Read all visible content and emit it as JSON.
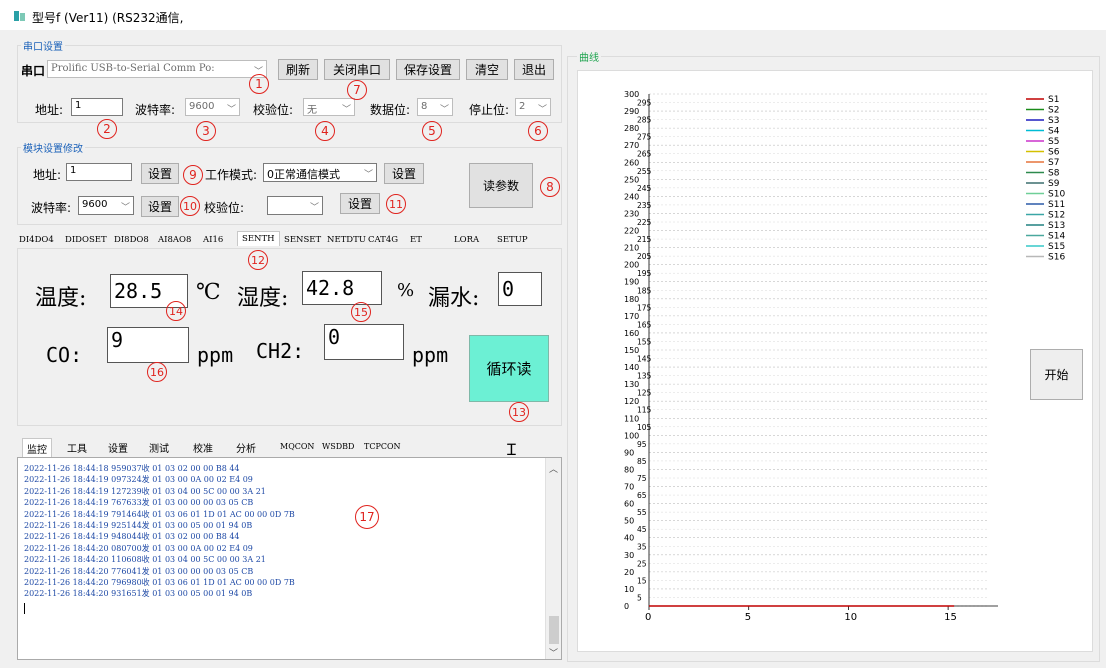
{
  "window": {
    "title": "型号f (Ver11)  (RS232通信,"
  },
  "serial_group": {
    "title": "串口设置",
    "port_label": "串口",
    "port_value": "Prolific USB-to-Serial Comm Po:",
    "refresh": "刷新",
    "close_port": "关闭串口",
    "save": "保存设置",
    "clear": "清空",
    "exit": "退出",
    "address_label": "地址:",
    "address_value": "1",
    "baud_label": "波特率:",
    "baud_value": "9600",
    "parity_label": "校验位:",
    "parity_value": "无",
    "databits_label": "数据位:",
    "databits_value": "8",
    "stopbits_label": "停止位:",
    "stopbits_value": "2"
  },
  "module_group": {
    "title": "模块设置修改",
    "address_label": "地址:",
    "address_value": "1",
    "set1": "设置",
    "workmode_label": "工作模式:",
    "workmode_value": "0正常通信模式",
    "set2": "设置",
    "read_params": "读参数",
    "baud_label": "波特率:",
    "baud_value": "9600",
    "set3": "设置",
    "parity_label": "校验位:",
    "parity_value": "",
    "set4": "设置"
  },
  "device_tabs": [
    "DI4DO4",
    "DIDOSET",
    "DI8DO8",
    "AI8AO8",
    "AI16",
    "SENTH",
    "SENSET",
    "NETDTU",
    "CAT4G",
    "ET",
    "LORA",
    "SETUP"
  ],
  "senth": {
    "temp_label": "温度:",
    "temp_value": "28.5",
    "temp_unit": "℃",
    "hum_label": "湿度:",
    "hum_value": "42.8",
    "hum_unit": "%",
    "leak_label": "漏水:",
    "leak_value": "0",
    "co_label": "CO:",
    "co_value": "9",
    "co_unit": "ppm",
    "ch2_label": "CH2:",
    "ch2_value": "0",
    "ch2_unit": "ppm",
    "loop_read": "循环读"
  },
  "bottom_tabs": [
    "监控",
    "工具",
    "设置",
    "测试",
    "校准",
    "分析",
    "MQCON",
    "WSDBD",
    "TCPCON"
  ],
  "log_lines": [
    "2022-11-26 18:44:18 959037收 01 03 02 00 00 B8 44",
    "2022-11-26 18:44:19 097324发 01 03 00 0A 00 02 E4 09",
    "2022-11-26 18:44:19 127239收 01 03 04 00 5C 00 00 3A 21",
    "2022-11-26 18:44:19 767633发 01 03 00 00 00 03 05 CB",
    "2022-11-26 18:44:19 791464收 01 03 06 01 1D 01 AC 00 00 0D 7B",
    "2022-11-26 18:44:19 925144发 01 03 00 05 00 01 94 0B",
    "2022-11-26 18:44:19 948044收 01 03 02 00 00 B8 44",
    "2022-11-26 18:44:20 080700发 01 03 00 0A 00 02 E4 09",
    "2022-11-26 18:44:20 110608收 01 03 04 00 5C 00 00 3A 21",
    "2022-11-26 18:44:20 776041发 01 03 00 00 00 03 05 CB",
    "2022-11-26 18:44:20 796980收 01 03 06 01 1D 01 AC 00 00 0D 7B",
    "2022-11-26 18:44:20 931651发 01 03 00 05 00 01 94 0B"
  ],
  "markers": [
    "1",
    "2",
    "3",
    "4",
    "5",
    "6",
    "7",
    "8",
    "9",
    "10",
    "11",
    "12",
    "13",
    "14",
    "15",
    "16",
    "17"
  ],
  "chart_group": {
    "title": "曲线",
    "start": "开始"
  },
  "chart_data": {
    "type": "line",
    "title": "",
    "xlabel": "",
    "ylabel": "",
    "xlim": [
      0,
      17
    ],
    "ylim": [
      0,
      300
    ],
    "x_ticks": [
      0,
      5,
      10,
      15
    ],
    "y_major_ticks": [
      0,
      10,
      20,
      30,
      40,
      50,
      60,
      70,
      80,
      90,
      100,
      110,
      120,
      130,
      140,
      150,
      160,
      170,
      180,
      190,
      200,
      210,
      220,
      230,
      240,
      250,
      260,
      270,
      280,
      290,
      300
    ],
    "y_minor_ticks": [
      5,
      15,
      25,
      35,
      45,
      55,
      65,
      75,
      85,
      95,
      105,
      115,
      125,
      135,
      145,
      155,
      165,
      175,
      185,
      195,
      205,
      215,
      225,
      235,
      245,
      255,
      265,
      275,
      285,
      295
    ],
    "grid": true,
    "legend_position": "right",
    "series": [
      {
        "name": "S1",
        "color": "#c00000",
        "x": [
          0,
          15.3
        ],
        "y": [
          0,
          0
        ]
      },
      {
        "name": "S2",
        "color": "#1a8c1a",
        "x": [],
        "y": []
      },
      {
        "name": "S3",
        "color": "#1f1fbf",
        "x": [],
        "y": []
      },
      {
        "name": "S4",
        "color": "#00bcd4",
        "x": [],
        "y": []
      },
      {
        "name": "S5",
        "color": "#cc33cc",
        "x": [],
        "y": []
      },
      {
        "name": "S6",
        "color": "#d4c000",
        "x": [],
        "y": []
      },
      {
        "name": "S7",
        "color": "#e6733c",
        "x": [],
        "y": []
      },
      {
        "name": "S8",
        "color": "#2d8a4e",
        "x": [],
        "y": []
      },
      {
        "name": "S9",
        "color": "#3c6e6e",
        "x": [],
        "y": []
      },
      {
        "name": "S10",
        "color": "#6fcf97",
        "x": [],
        "y": []
      },
      {
        "name": "S11",
        "color": "#2b5aa8",
        "x": [],
        "y": []
      },
      {
        "name": "S12",
        "color": "#3aa6a6",
        "x": [],
        "y": []
      },
      {
        "name": "S13",
        "color": "#208080",
        "x": [],
        "y": []
      },
      {
        "name": "S14",
        "color": "#4aa89e",
        "x": [],
        "y": []
      },
      {
        "name": "S15",
        "color": "#36c8c8",
        "x": [],
        "y": []
      },
      {
        "name": "S16",
        "color": "#b8b8b8",
        "x": [],
        "y": []
      }
    ]
  }
}
